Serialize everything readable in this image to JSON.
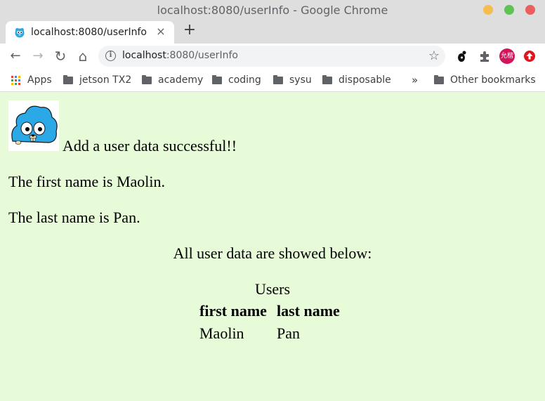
{
  "window": {
    "title": "localhost:8080/userInfo - Google Chrome",
    "colors": {
      "close": "#ec5f5f",
      "minimize": "#f5bd4f",
      "maximize": "#5dc453"
    }
  },
  "tab": {
    "title": "localhost:8080/userInfo",
    "favicon": "gopher-icon",
    "close_label": "×",
    "new_tab_label": "+"
  },
  "toolbar": {
    "back": "←",
    "forward": "→",
    "reload": "↻",
    "home": "⌂",
    "info_glyph": "i",
    "url_host": "localhost",
    "url_rest": ":8080/userInfo",
    "star": "☆",
    "profile_label": "允楷"
  },
  "bookmarks": {
    "apps": "Apps",
    "items": [
      "jetson TX2",
      "academy",
      "coding",
      "sysu",
      "disposable"
    ],
    "overflow": "»",
    "other": "Other bookmarks"
  },
  "page": {
    "success_message": "Add a user data successful!!",
    "first_name_line": "The first name is Maolin.",
    "last_name_line": "The last name is Pan.",
    "all_users_heading": "All user data are showed below:",
    "table": {
      "caption": "Users",
      "headers": [
        "first name",
        "last name"
      ],
      "rows": [
        [
          "Maolin",
          "Pan"
        ]
      ]
    }
  }
}
